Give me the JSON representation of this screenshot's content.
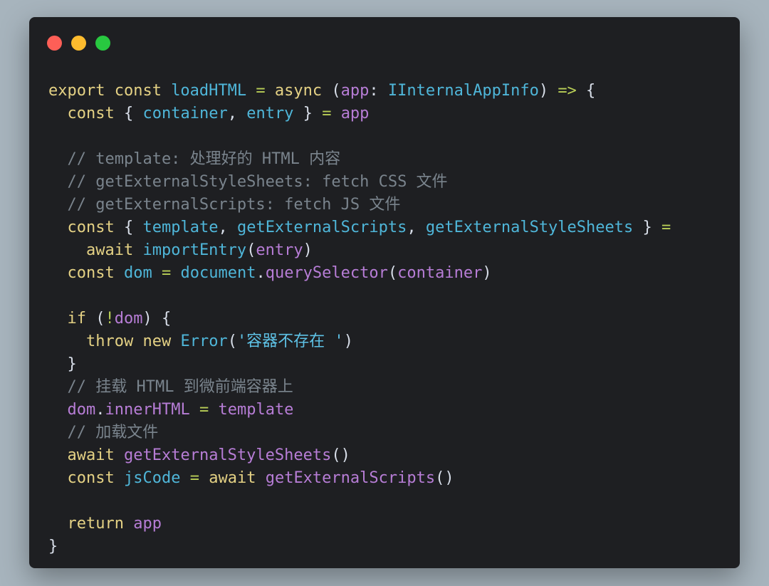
{
  "window": {
    "controls": [
      {
        "name": "close-control",
        "color": "#fe5f57"
      },
      {
        "name": "minimize-control",
        "color": "#febc2e"
      },
      {
        "name": "zoom-control",
        "color": "#28c840"
      }
    ]
  },
  "code": {
    "language": "typescript",
    "lines": [
      [
        [
          "kw",
          "export const "
        ],
        [
          "fn",
          "loadHTML"
        ],
        [
          "pu",
          " "
        ],
        [
          "op",
          "="
        ],
        [
          "pu",
          " "
        ],
        [
          "kw",
          "async"
        ],
        [
          "pu",
          " ("
        ],
        [
          "pa",
          "app"
        ],
        [
          "pu",
          ": "
        ],
        [
          "ty",
          "IInternalAppInfo"
        ],
        [
          "pu",
          ") "
        ],
        [
          "op",
          "=>"
        ],
        [
          "pu",
          " {"
        ]
      ],
      [
        [
          "pu",
          "  "
        ],
        [
          "kw",
          "const"
        ],
        [
          "pu",
          " { "
        ],
        [
          "pr",
          "container"
        ],
        [
          "pu",
          ", "
        ],
        [
          "pr",
          "entry"
        ],
        [
          "pu",
          " } "
        ],
        [
          "op",
          "="
        ],
        [
          "pu",
          " "
        ],
        [
          "id",
          "app"
        ]
      ],
      [],
      [
        [
          "cm",
          "  // template: 处理好的 HTML 内容"
        ]
      ],
      [
        [
          "cm",
          "  // getExternalStyleSheets: fetch CSS 文件"
        ]
      ],
      [
        [
          "cm",
          "  // getExternalScripts: fetch JS 文件"
        ]
      ],
      [
        [
          "pu",
          "  "
        ],
        [
          "kw",
          "const"
        ],
        [
          "pu",
          " { "
        ],
        [
          "pr",
          "template"
        ],
        [
          "pu",
          ", "
        ],
        [
          "pr",
          "getExternalScripts"
        ],
        [
          "pu",
          ", "
        ],
        [
          "pr",
          "getExternalStyleSheets"
        ],
        [
          "pu",
          " } "
        ],
        [
          "op",
          "="
        ]
      ],
      [
        [
          "pu",
          "    "
        ],
        [
          "kw",
          "await"
        ],
        [
          "pu",
          " "
        ],
        [
          "fn",
          "importEntry"
        ],
        [
          "pu",
          "("
        ],
        [
          "id",
          "entry"
        ],
        [
          "pu",
          ")"
        ]
      ],
      [
        [
          "pu",
          "  "
        ],
        [
          "kw",
          "const"
        ],
        [
          "pu",
          " "
        ],
        [
          "pr",
          "dom"
        ],
        [
          "pu",
          " "
        ],
        [
          "op",
          "="
        ],
        [
          "pu",
          " "
        ],
        [
          "fn",
          "document"
        ],
        [
          "pu",
          "."
        ],
        [
          "mt",
          "querySelector"
        ],
        [
          "pu",
          "("
        ],
        [
          "id",
          "container"
        ],
        [
          "pu",
          ")"
        ]
      ],
      [],
      [
        [
          "pu",
          "  "
        ],
        [
          "kw",
          "if"
        ],
        [
          "pu",
          " ("
        ],
        [
          "op",
          "!"
        ],
        [
          "id",
          "dom"
        ],
        [
          "pu",
          ") {"
        ]
      ],
      [
        [
          "pu",
          "    "
        ],
        [
          "kw",
          "throw new"
        ],
        [
          "pu",
          " "
        ],
        [
          "ty",
          "Error"
        ],
        [
          "pu",
          "("
        ],
        [
          "st",
          "'容器不存在 '"
        ],
        [
          "pu",
          ")"
        ]
      ],
      [
        [
          "pu",
          "  }"
        ]
      ],
      [
        [
          "cm",
          "  // 挂载 HTML 到微前端容器上"
        ]
      ],
      [
        [
          "pu",
          "  "
        ],
        [
          "id",
          "dom"
        ],
        [
          "pu",
          "."
        ],
        [
          "mt",
          "innerHTML"
        ],
        [
          "pu",
          " "
        ],
        [
          "op",
          "="
        ],
        [
          "pu",
          " "
        ],
        [
          "id",
          "template"
        ]
      ],
      [
        [
          "cm",
          "  // 加载文件"
        ]
      ],
      [
        [
          "pu",
          "  "
        ],
        [
          "kw",
          "await"
        ],
        [
          "pu",
          " "
        ],
        [
          "mt",
          "getExternalStyleSheets"
        ],
        [
          "pu",
          "()"
        ]
      ],
      [
        [
          "pu",
          "  "
        ],
        [
          "kw",
          "const"
        ],
        [
          "pu",
          " "
        ],
        [
          "pr",
          "jsCode"
        ],
        [
          "pu",
          " "
        ],
        [
          "op",
          "="
        ],
        [
          "pu",
          " "
        ],
        [
          "kw",
          "await"
        ],
        [
          "pu",
          " "
        ],
        [
          "mt",
          "getExternalScripts"
        ],
        [
          "pu",
          "()"
        ]
      ],
      [],
      [
        [
          "pu",
          "  "
        ],
        [
          "kw",
          "return"
        ],
        [
          "pu",
          " "
        ],
        [
          "id",
          "app"
        ]
      ],
      [
        [
          "pu",
          "}"
        ]
      ]
    ]
  }
}
